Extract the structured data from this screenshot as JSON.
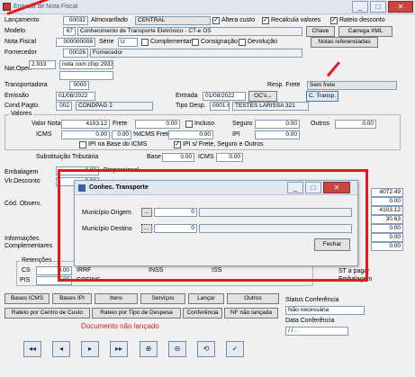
{
  "window": {
    "title": "Entrada de Nota Fiscal",
    "controls": [
      "_",
      "□",
      "✕"
    ]
  },
  "form": {
    "lancamento": {
      "label": "Lançamento",
      "value": "00032"
    },
    "almoxarifado": {
      "label": "Almoxarifado",
      "value": "CENTRAL"
    },
    "altera_custo": {
      "label": "Altera custo",
      "checked": true
    },
    "recalcula_valores": {
      "label": "Recalcula valores",
      "checked": true
    },
    "rateio_desconto": {
      "label": "Rateio desconto",
      "checked": true
    },
    "modelo": {
      "label": "Modelo",
      "code": "67",
      "desc": "Conhecimento de Transporte Eletrônico - CT-e OS"
    },
    "chave_btn": "Chave",
    "carrega_xml_btn": "Carrega XML",
    "nota_fiscal": {
      "label": "Nota Fiscal",
      "value": "000000008",
      "serie_label": "Série",
      "serie": "U"
    },
    "complementar": "Complementar",
    "consignacao": "Consignação",
    "devolucao": "Devolução",
    "notas_ref_btn": "Notas referenciadas",
    "fornecedor": {
      "label": "Fornecedor",
      "code": "00026",
      "name": "Fornecedor"
    },
    "nat_oper": {
      "label": "Nat.Oper.",
      "code": "2.933",
      "desc": "nota com cfop 2933"
    },
    "transportadora": {
      "label": "Transportadora",
      "value": "0000"
    },
    "resp_frete": {
      "label": "Resp. Frete",
      "value": "Sem frete"
    },
    "emissao": {
      "label": "Emissão",
      "value": "01/08/2022"
    },
    "entrada": {
      "label": "Entrada",
      "value": "01/08/2022"
    },
    "ocs_btn": "OC's...",
    "ctransp_btn": "C. Transp.",
    "cond_pagto": {
      "label": "Cond.Pagto.",
      "code": "002",
      "desc": "CONDPAG 2"
    },
    "tipo_desp": {
      "label": "Tipo Desp.",
      "code": "0001-9",
      "desc": "TESTES LARISSA 321"
    },
    "valores": {
      "title": "Valores",
      "valor_nota_label": "Valor Nota",
      "valor_nota": "4103.12",
      "frete_label": "Frete",
      "frete": "0.00",
      "incluso": "Incluso",
      "seguro_label": "Seguro",
      "seguro": "0.00",
      "outros_label": "Outros",
      "outros": "0.00",
      "icms_label": "ICMS",
      "icms": "0.00",
      "icms_frete_label": "%ICMS Frete",
      "icms_frete": "0.00",
      "ipi_label": "IPI",
      "ipi": "0.00",
      "ipi_base_icms": "IPI na Base do ICMS",
      "ipi_s_frete": "IPI s/ Frete, Seguro e Outros"
    },
    "subst": {
      "label": "Substituição Tributária",
      "base_label": "Base",
      "base": "0.00",
      "icms_label": "ICMS",
      "icms": "0.00"
    },
    "embalagem": {
      "label": "Embalagem",
      "value": "0.00"
    },
    "vl_desconto": {
      "label": "Vlr.Desconto",
      "value": "0.00"
    },
    "proporcional": "Proporcional",
    "cod_observ": "Cód. Observ.",
    "info_compl": "Informações Complementares",
    "right_values": [
      "4072.49",
      "0.00",
      "4103.12",
      "30.63",
      "0.00",
      "0.00",
      "0.00"
    ],
    "right_labels": [
      "ST a pagar",
      "Embalagem"
    ],
    "retencoes": {
      "title": "Retenções",
      "cs_label": "CS",
      "cs": "0.00",
      "pis_label": "PIS",
      "pis": "0.00",
      "irrf": "IRRF",
      "cofins": "COFINS",
      "inss": "INSS",
      "iss": "ISS"
    }
  },
  "tabs": [
    "Bases ICMS",
    "Bases IPI",
    "Itens",
    "Serviços",
    "Lançar",
    "Outros"
  ],
  "tabs2": [
    "Rateio por Centro de Custo",
    "Rateio por Tipo de Despesa",
    "Conferência",
    "NF não lançada"
  ],
  "status_conf": {
    "label": "Status Conferência",
    "value": "Não necessária"
  },
  "data_conf": {
    "label": "Data Conferência",
    "value": "/ /   : :"
  },
  "status_msg": "Documento não lançado",
  "nav": [
    "◂◂",
    "◂",
    "▸",
    "▸▸",
    "⊕",
    "⊖",
    "⟲",
    "✓"
  ],
  "modal": {
    "title": "Conhec. Transporte",
    "municipio_origem": {
      "label": "Município Origem",
      "btn": "...",
      "code": "0"
    },
    "municipio_destino": {
      "label": "Município Destino",
      "btn": "...",
      "code": "0"
    },
    "fechar": "Fechar"
  }
}
